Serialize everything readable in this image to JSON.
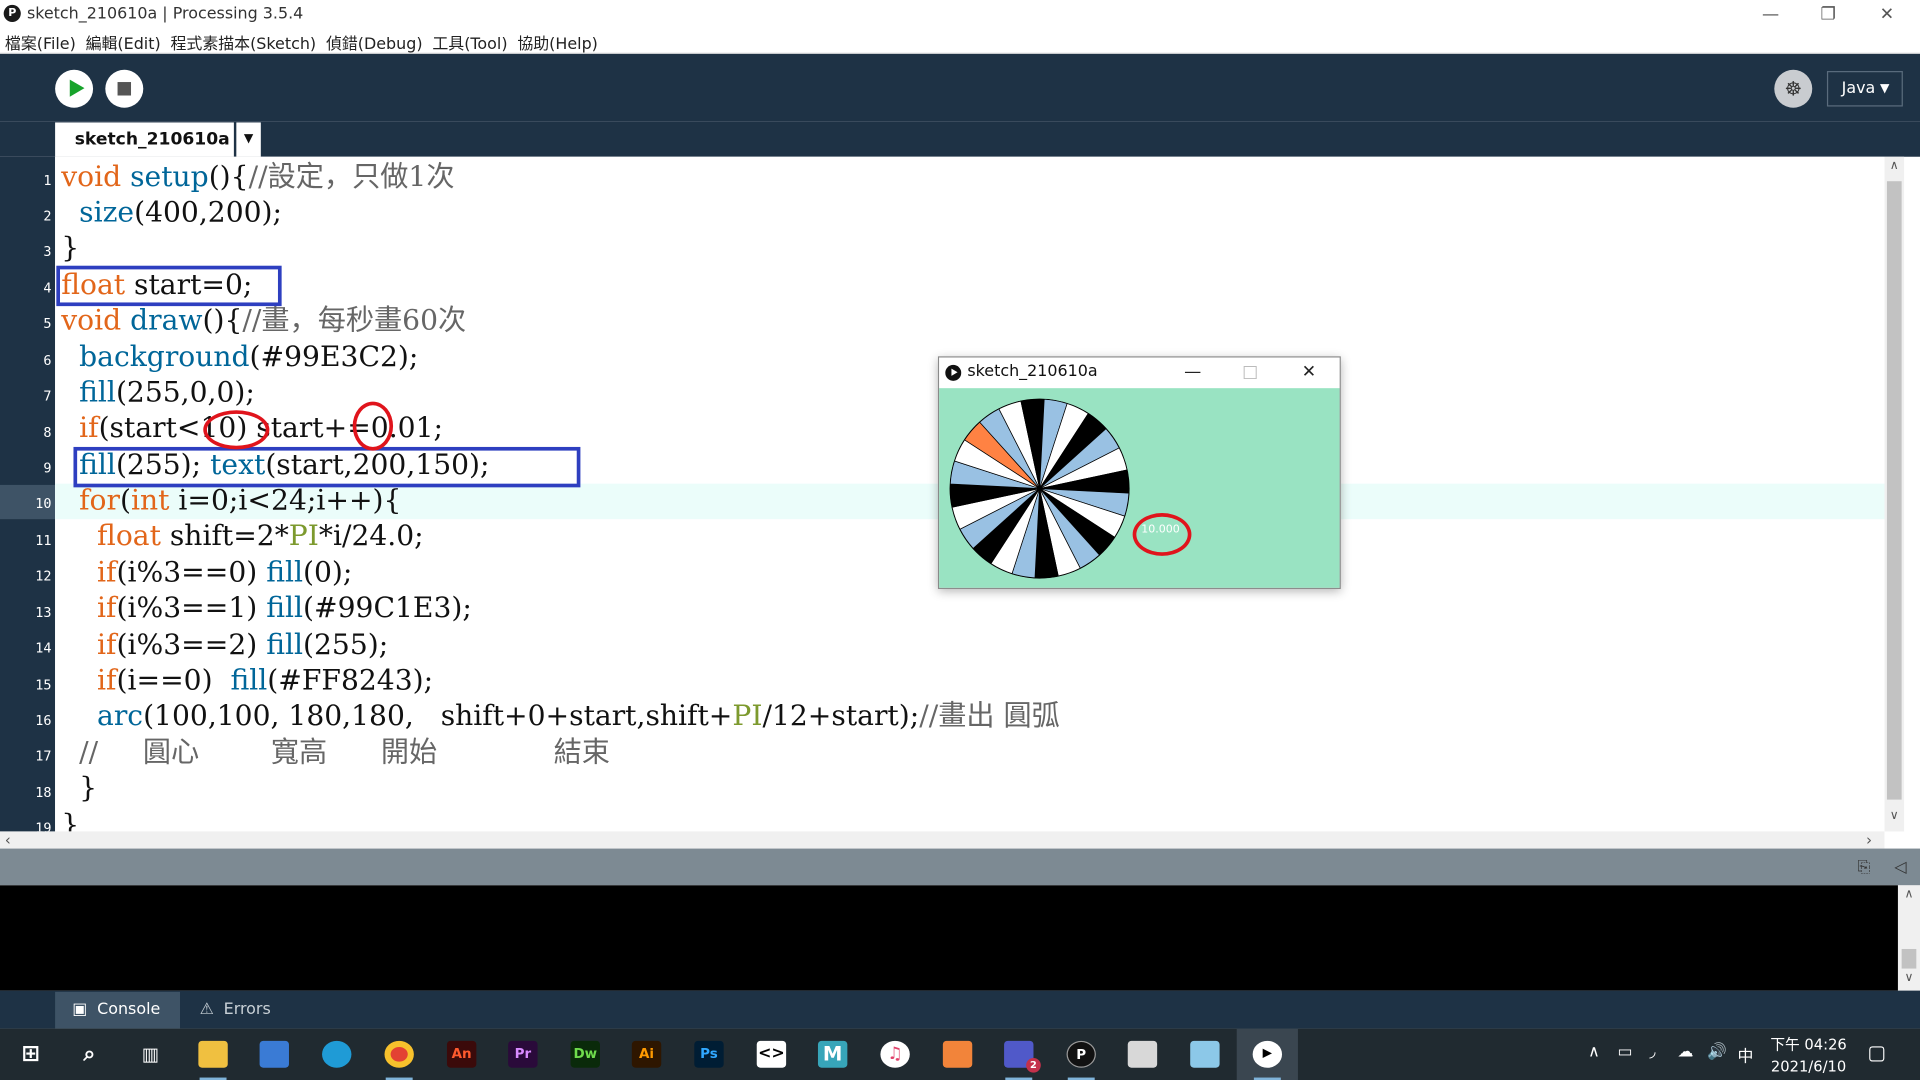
{
  "window": {
    "title": "sketch_210610a | Processing 3.5.4",
    "app_icon": "processing-logo-icon",
    "controls": [
      "minimize",
      "restore",
      "close"
    ]
  },
  "menu": [
    "檔案(File)",
    "編輯(Edit)",
    "程式素描本(Sketch)",
    "偵錯(Debug)",
    "工具(Tool)",
    "協助(Help)"
  ],
  "toolbar": {
    "run_icon": "play-icon",
    "stop_icon": "stop-icon",
    "debug_icon": "debugger-icon",
    "mode": "Java"
  },
  "tabs": {
    "active": "sketch_210610a",
    "menu_icon": "tab-dropdown-icon"
  },
  "editor": {
    "current_line": 10,
    "line_numbers": [
      "1",
      "2",
      "3",
      "4",
      "5",
      "6",
      "7",
      "8",
      "9",
      "10",
      "11",
      "12",
      "13",
      "14",
      "15",
      "16",
      "17",
      "18",
      "19"
    ],
    "lines": [
      "void setup(){//設定，只做1次",
      "  size(400,200);",
      "}",
      "float start=0;",
      "void draw(){//畫，每秒畫60次",
      "  background(#99E3C2);",
      "  fill(255,0,0);",
      "  if(start<10) start+=0.01;",
      "  fill(255); text(start,200,150);",
      "  for(int i=0;i<24;i++){",
      "    float shift=2*PI*i/24.0;",
      "    if(i%3==0) fill(0);",
      "    if(i%3==1) fill(#99C1E3);",
      "    if(i%3==2) fill(255);",
      "    if(i==0)  fill(#FF8243);",
      "    arc(100,100, 180,180,   shift+0+start,shift+PI/12+start);//畫出 圓弧",
      "  //     圓心        寬高      開始             結束",
      "  }",
      "}"
    ]
  },
  "annotations": {
    "rect_color": "#2E3FC0",
    "oval_color": "#E0141C"
  },
  "console": {
    "tabs": [
      {
        "label": "Console",
        "icon": "console-icon"
      },
      {
        "label": "Errors",
        "icon": "warning-icon"
      }
    ],
    "status_icons": [
      "copy-icon",
      "collapse-icon"
    ]
  },
  "sketch_window": {
    "title": "sketch_210610a",
    "background": "#99E3C2",
    "displayed_value": "10.000",
    "wheel_colors": [
      "#FF8243",
      "#99C1E3",
      "#FFFFFF",
      "#000000"
    ]
  },
  "taskbar": {
    "apps": [
      "start-icon",
      "search-icon",
      "task-view-icon",
      "file-explorer-icon",
      "store-icon",
      "edge-icon",
      "chrome-icon",
      "animate-icon",
      "premiere-icon",
      "dreamweaver-icon",
      "illustrator-icon",
      "photoshop-icon",
      "codeblocks-icon",
      "maya-icon",
      "itunes-icon",
      "app-icon",
      "teams-icon",
      "processing-icon",
      "paint-icon",
      "notepad-icon",
      "sketch-run-icon"
    ],
    "app_labels": {
      "animate": "An",
      "premiere": "Pr",
      "dreamweaver": "Dw",
      "illustrator": "Ai",
      "photoshop": "Ps",
      "maya": "M",
      "teams_badge": "2"
    },
    "ime": "中",
    "time": "下午 04:26",
    "date": "2021/6/10"
  }
}
